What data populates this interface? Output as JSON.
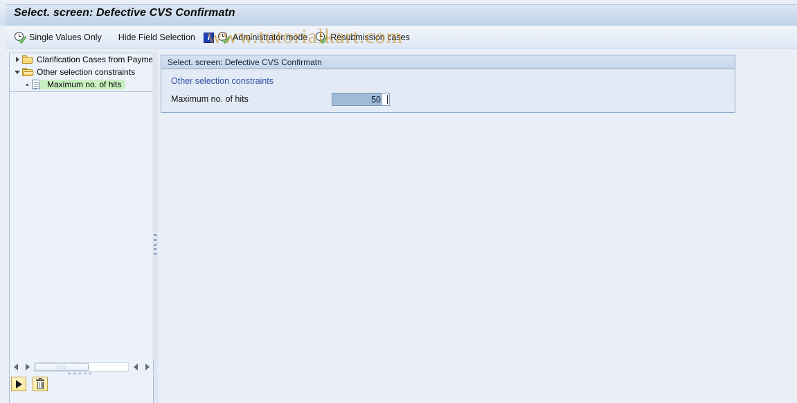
{
  "window": {
    "title": "Select. screen: Defective CVS Confirmatn"
  },
  "toolbar": {
    "items": [
      {
        "label": "Single Values Only",
        "icon": "clock-check-icon"
      },
      {
        "label": "Hide Field Selection",
        "icon": ""
      },
      {
        "label": "",
        "icon": "info-icon"
      },
      {
        "label": "Administrator mode",
        "icon": "clock-check-icon"
      },
      {
        "label": "Resubmission cases",
        "icon": "clock-check-icon"
      }
    ]
  },
  "watermark": {
    "text": "www.tutorialkart.com",
    "color": "#c8922c"
  },
  "tree": {
    "items": [
      {
        "label": "Clarification Cases from Paymer",
        "icon": "folder-closed-icon",
        "twisty": "right",
        "selected": false
      },
      {
        "label": "Other selection constraints",
        "icon": "folder-open-icon",
        "twisty": "down",
        "selected": false
      },
      {
        "label": "Maximum no. of hits",
        "icon": "document-icon",
        "twisty": "dot",
        "selected": true
      }
    ],
    "buttons": [
      {
        "name": "execute-button",
        "icon": "play-icon"
      },
      {
        "name": "delete-button",
        "icon": "trash-icon"
      }
    ],
    "scrollbar": {
      "left_arrow": "◀",
      "right_arrow": "▶"
    }
  },
  "content": {
    "header": "Select. screen: Defective CVS Confirmatn",
    "group_title": "Other selection constraints",
    "field": {
      "label": "Maximum no. of hits",
      "value": "50",
      "placeholder": ""
    }
  },
  "colors": {
    "accent": "#2f4fa8",
    "selection_green": "#c9f0c0",
    "input_selection": "#9fbbd8",
    "background": "#e9eef7"
  }
}
